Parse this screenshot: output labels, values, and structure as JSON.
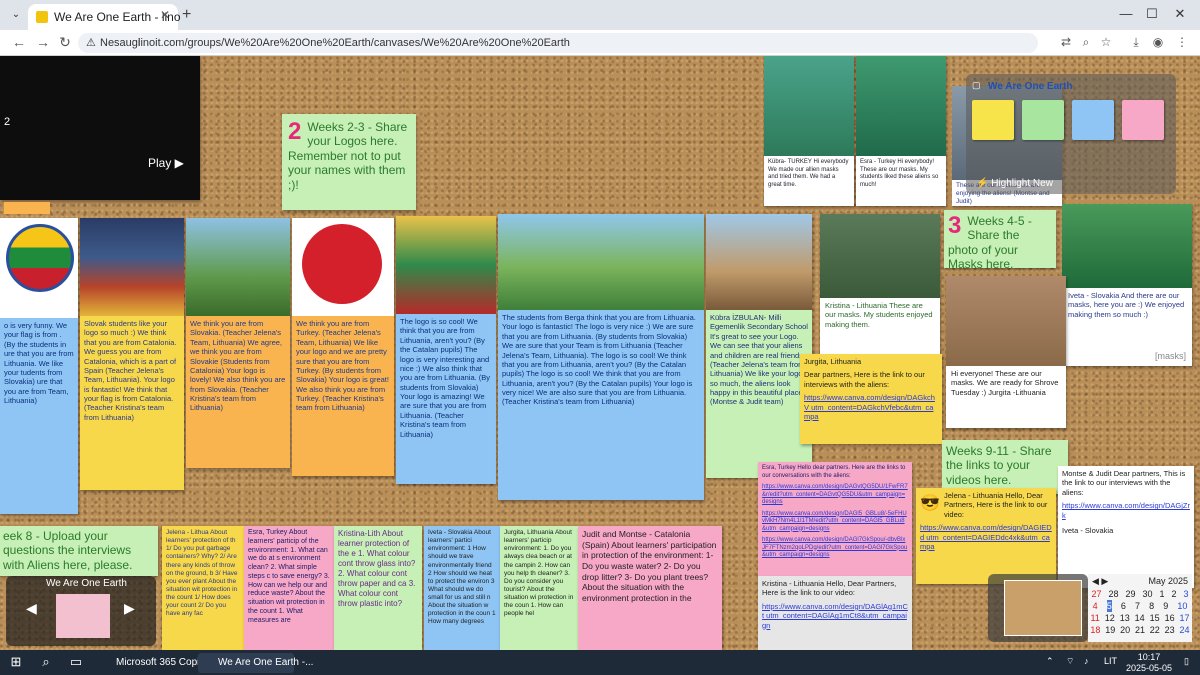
{
  "browser": {
    "tab_title": "We Are One Earth - lino",
    "url_warning": "Nesaugi",
    "url": "linoit.com/groups/We%20Are%20One%20Earth/canvases/We%20Are%20One%20Earth"
  },
  "video": {
    "play_label": "Play",
    "side_number": "2"
  },
  "stickers": {
    "weeks23": {
      "num": "2",
      "text": "Weeks 2-3 - Share your Logos here. Remember not to put your names with them ;)!"
    },
    "weeks45": {
      "num": "3",
      "text": "Weeks 4-5 - Share the photo of your Masks here."
    },
    "weeks911": {
      "text": "Weeks 9-11 - Share the links to your videos here."
    },
    "week8": {
      "text": "eek 8 - Upload your questions the interviews with Aliens here, please."
    },
    "a1": "o is very funny. We your flag is from . (By the students in ure that you are from Lithuania. We like your tudents from Slovakia) ure that you are from Team, Lithuania)",
    "a2": "Slovak students like your logo so much :) We think that you are from Catalonia. We guess you are from Catalonia, which is a part of Spain (Teacher Jelena's Team, Lithuania). Your logo is fantastic! We think that your flag is from Catalonia. (Teacher Kristina's team from Lithuania)",
    "a3": "We think you are from Slovakia. (Teacher Jelena's Team, Lithuania) We agree, we think you are from Slovakie (Students from Catalonia) Your logo is lovely! We also think you are from Slovakia. (Teacher Kristina's team from Lithuania)",
    "a4": "We think you are from Turkey. (Teacher Jelena's Team, Lithuania) We like your logo and we are pretty sure that you are from Turkey. (By students from Slovakia) Your logo is great! We also think you are from Turkey. (Teacher Kristina's team from Lithuania)",
    "a5": "The logo is so cool! We think that you are from Lithuania, aren't you? (By the Catalan pupils) The logo is very interesting and nice :) We also think that you are from Lithuania. (By students from Slovakia) Your logo is amazing! We are sure that you are from Lithuania. (Teacher Kristina's team from Lithuania)",
    "a6": "The students from Berga think that you are from Lithuania. Your logo is fantastic! The logo is very nice :) We are sure that you are from Lithuania. (By students from Slovakia) We are sure that your Team is from Lithuania (Teacher Jelena's Team, Lithuania). The logo is so cool! We think that you are from Lithuania, aren't you? (By the Catalan pupils) The logo is so cool! We think that you are from Lithuania, aren't you? (By the Catalan pupils) Your logo is very nice! We are also sure that you are from Lithuania. (Teacher Kristina's team from Lithuania)",
    "a7": "Kübra İZBULAN- Milli Egemenlik Secondary School It's great to see your Logo. We can see that your aliens and children are real friends (Teacher Jelena's team from Lithuania) We like your logo so much, the aliens look happy in this beautiful place! (Montse & Judit team)",
    "kubra": "Kübra- TURKEY Hi everybody We made our allien masks and tried them. We had a great time.",
    "esra": "Esra - Turkey Hi everybody! These are our masks. My students liked these aliens so much!",
    "enjoy": "These are our masks, we are enjoying the aliens! (Montse and Judit)",
    "kristina_masks": "Kristina - Lithuania These are our masks. My students enjoyed making them.",
    "iveta_masks": "Iveta - Slovakia And there are our masks, here you are :) We enjoyed making them so much :)",
    "masks_tag": "[masks]",
    "jurgita_masks": "Hi everyone! These are our masks. We are ready for Shrove Tuesday :) Jurgita -Lithuania",
    "jurgita_link_title": "Jurgita, Lithuania",
    "jurgita_link_body": "Dear partners, Here is the link to our interviews with the aliens:",
    "jurgita_url": "https://www.canva.com/design/DAGkchV utm_content=DAGkchVfebc&utm_campa",
    "esra_videos_title": "Esra, Turkey Hello dear partners. Here are the links to our conversations with the aliens:",
    "esra_url1": "https://www.canva.com/design/DAGvtQG5DU/1FwFR7&r/edit?utm_content=DAGvtQG5DU&utm_campaign=designs",
    "esra_url2": "https://www.canva.com/design/DAGl5_GBLu8/-5eFHUvMkH7Nm4L1I1TM/edit?utm_content=DAGl5_GBLu8&utm_campaign=designs",
    "esra_url3": "https://www.canva.com/design/DAGl7GkSpou/-dbvBlxJF7FTNzm2qoLPDg/edit?utm_content=DAGl7GkSpou&utm_campaign=designs",
    "jelena_video_title": "Jelena - Lithuania Hello, Dear Partners, Here is the link to our video:",
    "jelena_url": "https://www.canva.com/design/DAGIEDd utm_content=DAGIEDdc4xk&utm_campa",
    "kristina_video": "Kristina - Lithuania Hello, Dear Partners, Here is the link to our video:",
    "kristina_url": "https://www.canva.com/design/DAGlAg1mCt utm_content=DAGlAg1mCt8&utm_campaign",
    "montse_video": "Montse & Judit Dear partners, This is the link to our interviews with the aliens:",
    "montse_url": "https://www.canva.com/design/DAGjZrk",
    "iveta_video": "Iveta - Slovakia",
    "q_jelena": "Jelena - Lithua About learners' protection of th 1/ Do you put garbage containers? Why? 2/ Are there any kinds of throw on the ground, b 3/ Have you ever plant About the situation wit protection in the count 1/ How does your count 2/ Do you have any fac",
    "q_esra": "Esra, Turkey About learners' particip of the environment: 1. What can we do at s environment clean? 2. What simple steps c to save energy? 3. How can we help our and reduce waste? About the situation wit protection in the count 1. What measures are",
    "q_kristina": "Kristina-Lith About learner protection of the e 1. What colour cont throw glass into? 2. What colour cont throw paper and ca 3. What colour cont throw plastic into?",
    "q_iveta": "Iveta - Slovakia About learners' partici environment: 1 How should we trave environmentally friend 2 How should we heat to protect the environ 3 What should we do small for us and still n About the situation w protection in the coun 1 How many degrees",
    "q_jurgita": "Jurgita, Lithuania About learners' particip environment: 1. Do you always clea beach or at the campin 2. How can you help th cleaner? 3. Do you consider you tourist? About the situation wi protection in the coun 1. How can people hel",
    "q_judit": "Judit and Montse - Catalonia (Spain) About learners' participation in protection of the environment: 1- Do you waste water? 2- Do you drop litter? 3- Do you plant trees? About the situation with the environment protection in the"
  },
  "palette": {
    "title": "We Are One Earth",
    "highlight": "Highlight New"
  },
  "slideshow": {
    "title": "We Are One Earth"
  },
  "calendar": {
    "title": "May 2025",
    "rows": [
      [
        "27",
        "28",
        "29",
        "30",
        "1",
        "2",
        "3"
      ],
      [
        "4",
        "5",
        "6",
        "7",
        "8",
        "9",
        "10"
      ],
      [
        "11",
        "12",
        "13",
        "14",
        "15",
        "16",
        "17"
      ],
      [
        "18",
        "19",
        "20",
        "21",
        "22",
        "23",
        "24"
      ]
    ]
  },
  "taskbar": {
    "app1": "Microsoft 365 Copil...",
    "app2": "We Are One Earth -...",
    "lang": "LIT",
    "time": "10:17",
    "date": "2025-05-05"
  }
}
